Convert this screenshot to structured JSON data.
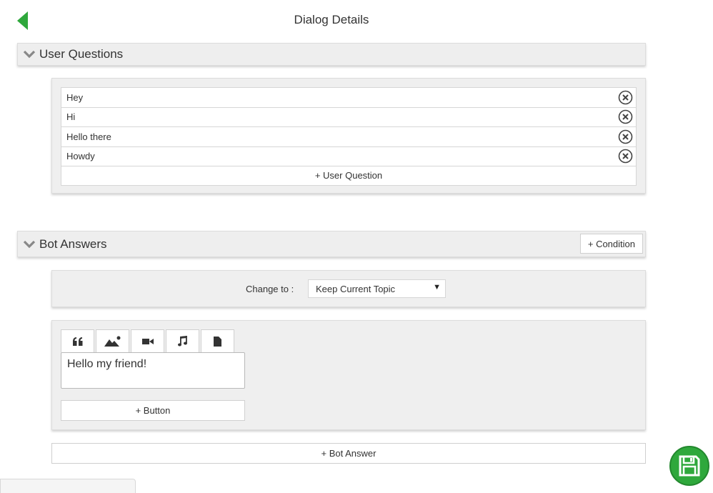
{
  "header": {
    "back_icon": "back-arrow-icon",
    "title": "Dialog Details"
  },
  "colors": {
    "accent_green": "#2fa83c",
    "panel_bg": "#efefef"
  },
  "user_questions": {
    "title": "User Questions",
    "items": [
      {
        "text": "Hey"
      },
      {
        "text": "Hi"
      },
      {
        "text": "Hello there"
      },
      {
        "text": "Howdy"
      }
    ],
    "add_label": "+ User Question"
  },
  "bot_answers": {
    "title": "Bot Answers",
    "condition_label": "+ Condition",
    "change_to_label": "Change to :",
    "topic_selected": "Keep Current Topic",
    "answer_types": [
      "quote-icon",
      "image-icon",
      "video-icon",
      "music-icon",
      "file-icon"
    ],
    "answer_text": "Hello my friend!",
    "add_button_label": "+ Button",
    "add_answer_label": "+ Bot Answer"
  },
  "save": {
    "icon": "save-icon"
  }
}
